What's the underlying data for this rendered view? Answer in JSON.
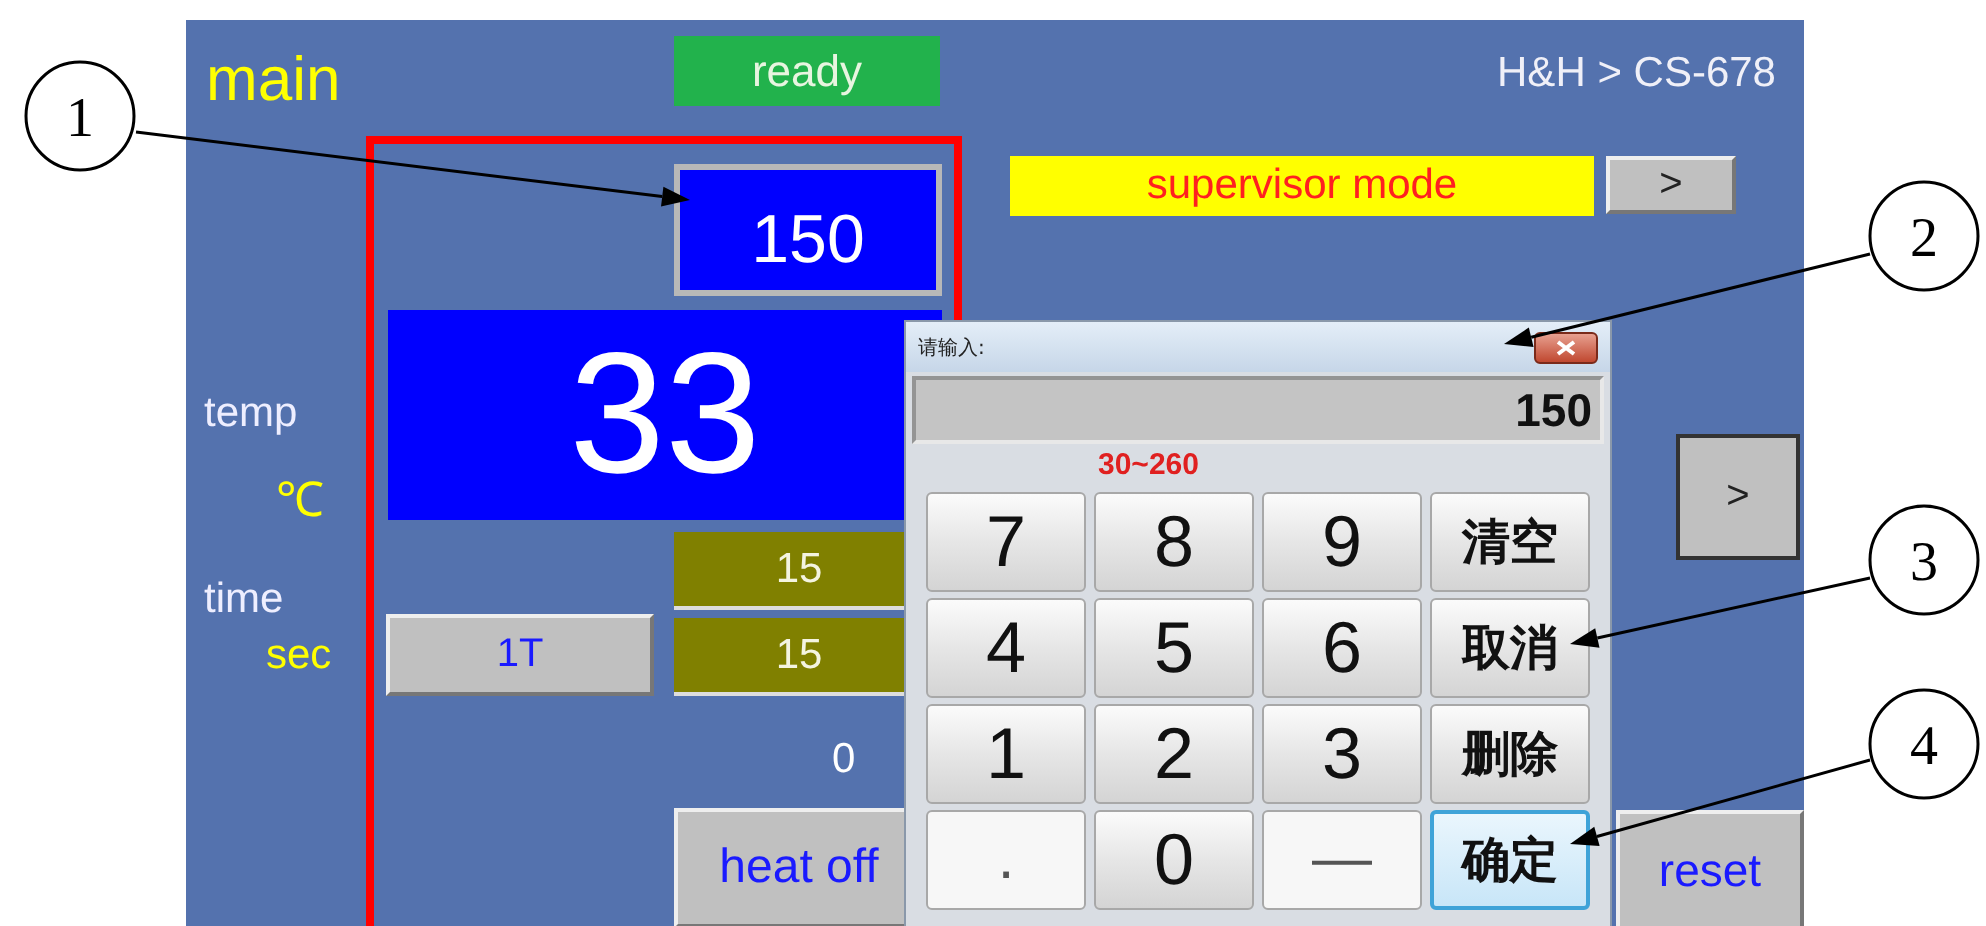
{
  "screen": {
    "title": "main",
    "status": "ready",
    "breadcrumb": "H&H > CS-678",
    "mode": "supervisor mode",
    "mode_button": ">",
    "setpoint": "150",
    "temperature": "33",
    "temp_label": "temp",
    "temp_unit": "℃",
    "time_label": "time",
    "time_unit": "sec",
    "cycle_button": "1T",
    "time_values": [
      "15",
      "15"
    ],
    "counter": "0",
    "heat_button": "heat off",
    "next_button": ">",
    "reset_button": "reset"
  },
  "dialog": {
    "title": "请输入:",
    "value": "150",
    "range": "30~260",
    "keys": [
      {
        "label": "7",
        "kind": "digit",
        "disabled": false,
        "focused": false
      },
      {
        "label": "8",
        "kind": "digit",
        "disabled": false,
        "focused": false
      },
      {
        "label": "9",
        "kind": "digit",
        "disabled": false,
        "focused": false
      },
      {
        "label": "清空",
        "kind": "action",
        "disabled": false,
        "focused": false
      },
      {
        "label": "4",
        "kind": "digit",
        "disabled": false,
        "focused": false
      },
      {
        "label": "5",
        "kind": "digit",
        "disabled": false,
        "focused": false
      },
      {
        "label": "6",
        "kind": "digit",
        "disabled": false,
        "focused": false
      },
      {
        "label": "取消",
        "kind": "action",
        "disabled": false,
        "focused": false
      },
      {
        "label": "1",
        "kind": "digit",
        "disabled": false,
        "focused": false
      },
      {
        "label": "2",
        "kind": "digit",
        "disabled": false,
        "focused": false
      },
      {
        "label": "3",
        "kind": "digit",
        "disabled": false,
        "focused": false
      },
      {
        "label": "删除",
        "kind": "action",
        "disabled": false,
        "focused": false
      },
      {
        "label": ".",
        "kind": "digit",
        "disabled": true,
        "focused": false
      },
      {
        "label": "0",
        "kind": "digit",
        "disabled": false,
        "focused": false
      },
      {
        "label": "—",
        "kind": "digit",
        "disabled": true,
        "focused": false
      },
      {
        "label": "确定",
        "kind": "action",
        "disabled": false,
        "focused": true
      }
    ]
  },
  "callouts": [
    {
      "label": "1"
    },
    {
      "label": "2"
    },
    {
      "label": "3"
    },
    {
      "label": "4"
    }
  ]
}
